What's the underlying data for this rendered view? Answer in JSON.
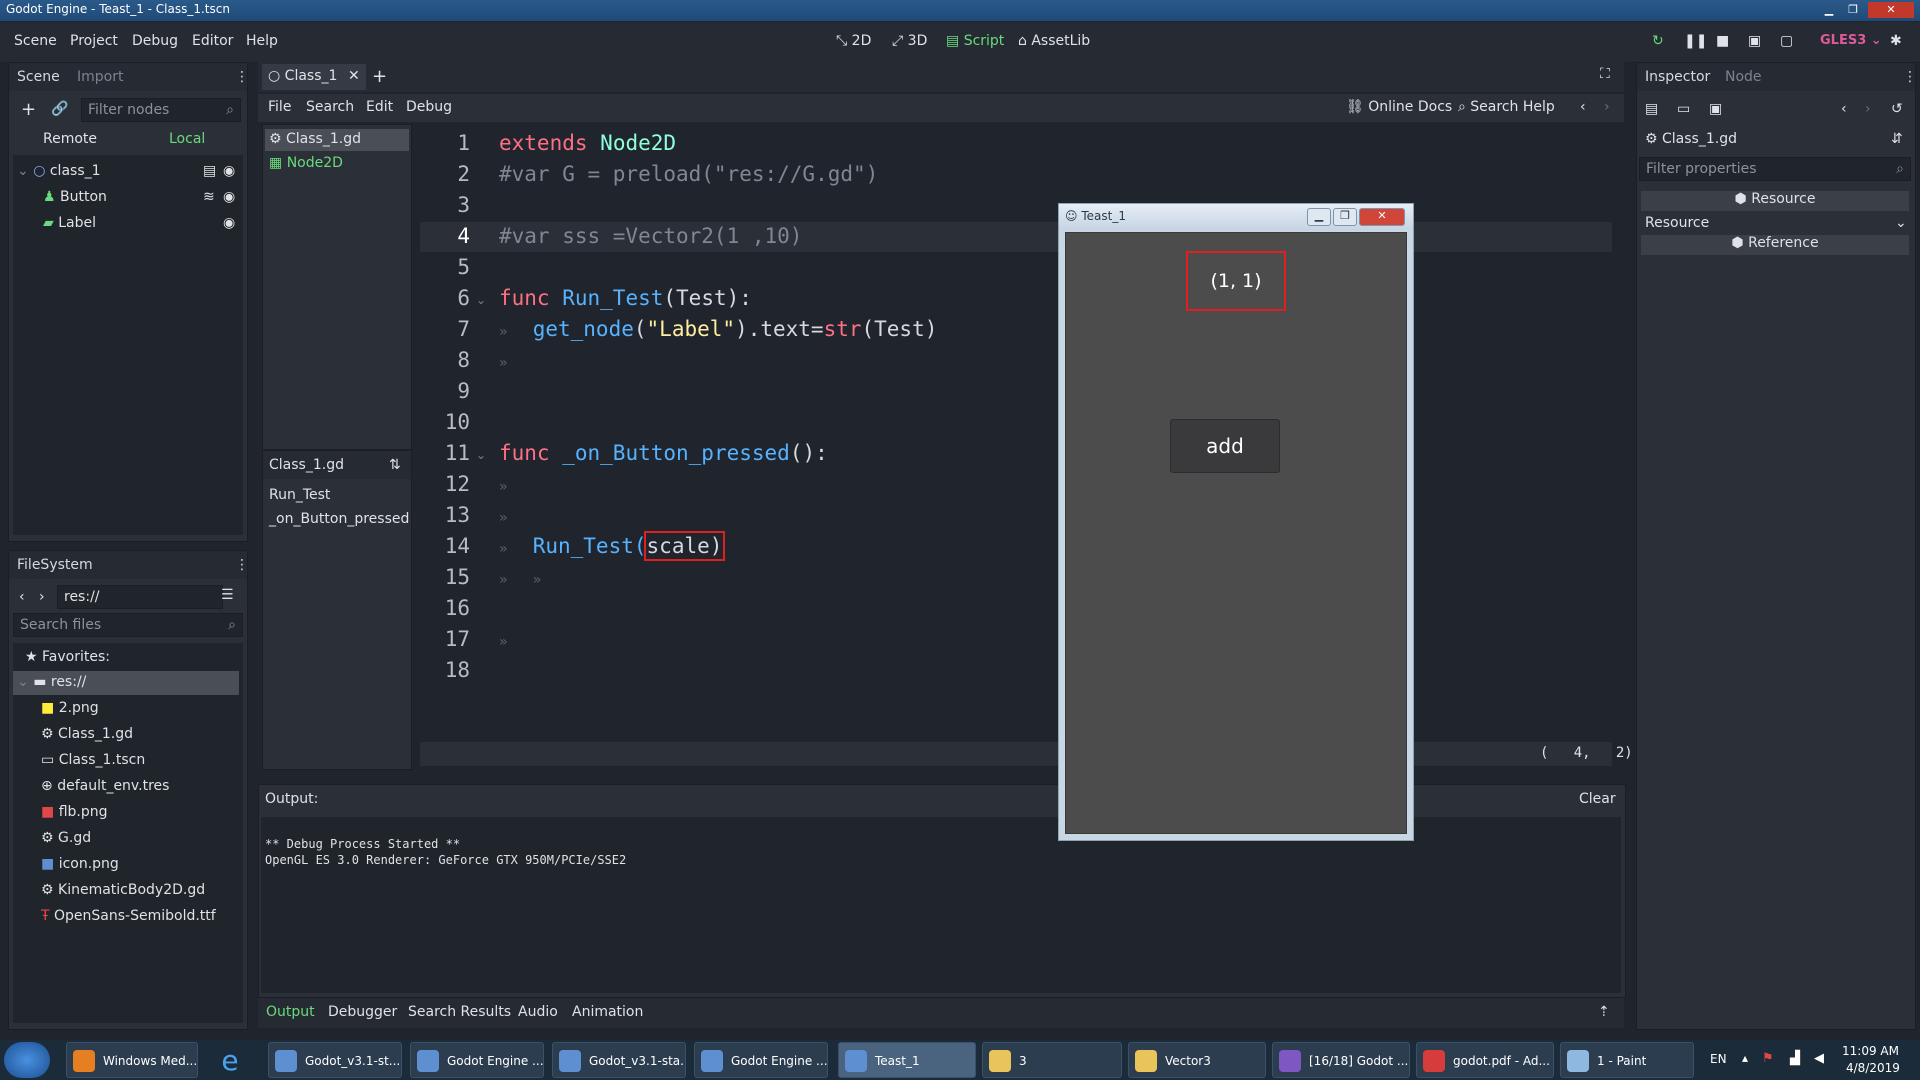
{
  "window_title": "Godot Engine - Teast_1 - Class_1.tscn",
  "menu": [
    "Scene",
    "Project",
    "Debug",
    "Editor",
    "Help"
  ],
  "workspaces": [
    "2D",
    "3D",
    "Script",
    "AssetLib"
  ],
  "renderer": "GLES3",
  "scene_dock": {
    "tabs": [
      "Scene",
      "Import"
    ],
    "filter_placeholder": "Filter nodes",
    "remote": "Remote",
    "local": "Local",
    "tree": [
      "class_1",
      "Button",
      "Label"
    ]
  },
  "filesystem": {
    "title": "FileSystem",
    "path": "res://",
    "search_placeholder": "Search files",
    "favorites": "Favorites:",
    "root": "res://",
    "files": [
      "2.png",
      "Class_1.gd",
      "Class_1.tscn",
      "default_env.tres",
      "flb.png",
      "G.gd",
      "icon.png",
      "KinematicBody2D.gd",
      "OpenSans-Semibold.ttf"
    ]
  },
  "script_editor": {
    "tab": "Class_1",
    "menu": [
      "File",
      "Search",
      "Edit",
      "Debug"
    ],
    "online_docs": "Online Docs",
    "search_help": "Search Help",
    "scripts": [
      "Class_1.gd",
      "Node2D"
    ],
    "current_script": "Class_1.gd",
    "methods": [
      "Run_Test",
      "_on_Button_pressed"
    ],
    "line_numbers": [
      "1",
      "2",
      "3",
      "4",
      "5",
      "6",
      "7",
      "8",
      "9",
      "10",
      "11",
      "12",
      "13",
      "14",
      "15",
      "16",
      "17",
      "18"
    ],
    "code": {
      "l1_kw": "extends",
      "l1_type": "Node2D",
      "l2": "#var G = preload(\"res://G.gd\")",
      "l4": "#var sss =Vector2(1 ,10)",
      "l6_kw": "func",
      "l6_fn": "Run_Test",
      "l6_rest": "(Test):",
      "l7_a": "get_node",
      "l7_b": "(",
      "l7_str": "\"Label\"",
      "l7_c": ").text=",
      "l7_str_fn": "str",
      "l7_d": "(Test)",
      "l11_kw": "func",
      "l11_fn": "_on_Button_pressed",
      "l11_rest": "():",
      "l14_fn": "Run_Test",
      "l14_paren": "(",
      "l14_arg": "scale)"
    },
    "cursor_pos": "(   4,   2)"
  },
  "output": {
    "label": "Output:",
    "clear": "Clear",
    "lines": [
      "** Debug Process Started **",
      "OpenGL ES 3.0 Renderer: GeForce GTX 950M/PCIe/SSE2"
    ],
    "bottom_tabs": [
      "Output",
      "Debugger",
      "Search Results",
      "Audio",
      "Animation"
    ]
  },
  "inspector": {
    "tabs": [
      "Inspector",
      "Node"
    ],
    "object": "Class_1.gd",
    "filter_placeholder": "Filter properties",
    "section": "Resource",
    "property": "Resource",
    "reference": "Reference"
  },
  "game_window": {
    "title": "Teast_1",
    "label_text": "(1, 1)",
    "button_text": "add"
  },
  "taskbar": {
    "items": [
      "Windows Med...",
      "Godot_v3.1-st...",
      "Godot Engine ...",
      "Godot_v3.1-sta...",
      "Godot Engine ...",
      "Teast_1",
      "3",
      "Vector3",
      "[16/18] Godot ...",
      "godot.pdf - Ad...",
      "1 - Paint"
    ],
    "lang": "EN",
    "time": "11:09 AM",
    "date": "4/8/2019"
  },
  "colors": {
    "accent": "#69db7c",
    "highlight_red": "#e02020",
    "keyword": "#ff7085",
    "function": "#57b3ff"
  }
}
